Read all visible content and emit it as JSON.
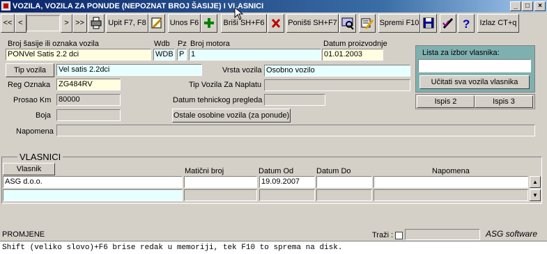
{
  "window": {
    "title": "VOZILA, VOZILA ZA PONUDE (NEPOZNAT BROJ ŠASIJE) I VLASNICI",
    "minimize": "_",
    "maximize": "□",
    "close": "×"
  },
  "toolbar": {
    "first": "<<",
    "prev": "<",
    "record_value": "",
    "next": ">",
    "last": ">>",
    "print_icon": "printer-icon",
    "query": "Upit F7, F8",
    "query_icon": "pencil-edit-icon",
    "insert": "Unos F6",
    "insert_icon": "green-plus-icon",
    "delete": "Briši SH+F6",
    "delete_icon": "red-x-icon",
    "cancel": "Poništi SH+F7",
    "cancel_icon": "screen-search-icon",
    "clear_icon": "eraser-icon",
    "save": "Spremi F10",
    "save_icon": "floppy-disk-icon",
    "edit_icon": "pen-check-icon",
    "help_icon": "question-mark-icon",
    "exit": "Izlaz CT+q"
  },
  "vehicle": {
    "chassis_label": "Broj šasije ili oznaka vozila",
    "chassis_value": "PONVel Satis 2.2 dci",
    "wdb_label": "Wdb",
    "wdb_value": "WDB",
    "pz_label": "Pz",
    "pz_value": "P",
    "engine_label": "Broj motora",
    "engine_value": "1",
    "prod_date_label": "Datum proizvodnje",
    "prod_date_value": "01.01.2003",
    "type_button": "Tip vozila",
    "type_value": "Vel satis 2.2dci",
    "kind_label": "Vrsta vozila",
    "kind_value": "Osobno vozilo",
    "reg_label": "Reg Oznaka",
    "reg_value": "ZG484RV",
    "toll_label": "Tip Vozila Za Naplatu",
    "toll_value": "",
    "km_label": "Prosao Km",
    "km_value": "80000",
    "inspection_label": "Datum tehnickog pregleda",
    "inspection_value": "",
    "color_label": "Boja",
    "color_value": "",
    "other_props_button": "Ostale osobine vozila (za ponude)",
    "note_label": "Napomena",
    "note_value": ""
  },
  "owner_panel": {
    "title": "Lista za izbor vlasnika:",
    "input_value": "",
    "load_button": "Učitati sva vozila vlasnika",
    "print2": "Ispis 2",
    "print3": "Ispis 3"
  },
  "owners": {
    "section_title": "VLASNICI",
    "owner_button": "Vlasnik",
    "col_mb": "Matični broj",
    "col_from": "Datum Od",
    "col_to": "Datum Do",
    "col_note": "Napomena",
    "rows": [
      {
        "owner": "ASG d.o.o.",
        "mb": "",
        "from": "19.09.2007",
        "to": "",
        "note": ""
      },
      {
        "owner": "",
        "mb": "",
        "from": "",
        "to": "",
        "note": ""
      }
    ]
  },
  "footer": {
    "block_name": "PROMJENE",
    "search_label": "Traži :",
    "search_value": "",
    "brand": "ASG software",
    "status": "Shift (veliko slovo)+F6 brise redak u memoriji, tek F10 to sprema na disk."
  },
  "colors": {
    "title_bg": "#0a246a",
    "window_bg": "#d4d0c8",
    "field_yellow": "#ffffe0",
    "field_cyan": "#e6ffff",
    "panel_teal": "#7fb0b0"
  }
}
